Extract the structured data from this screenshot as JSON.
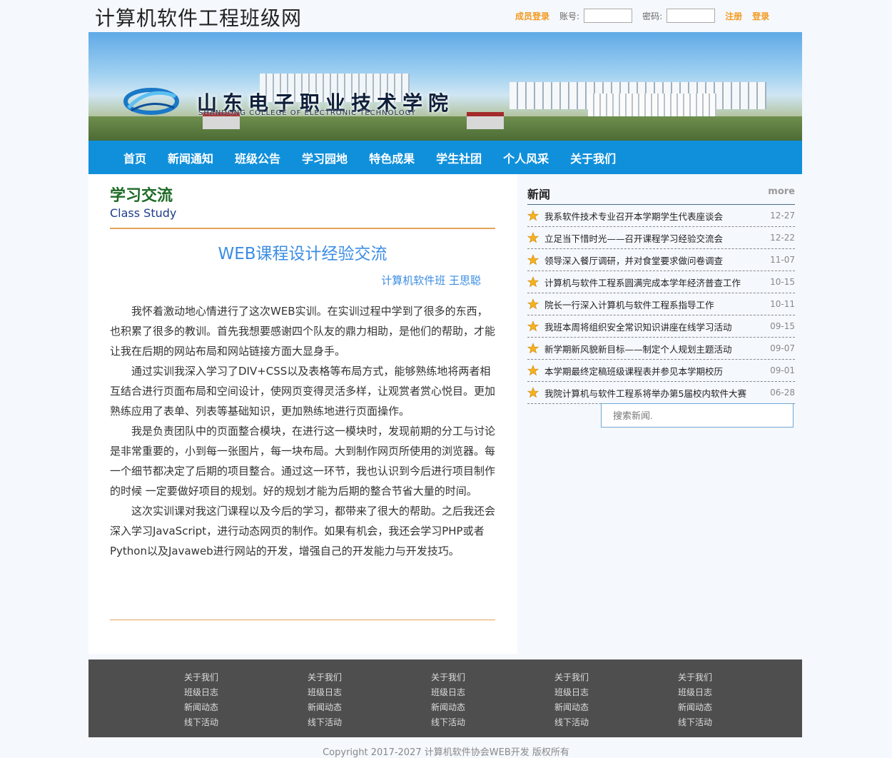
{
  "header": {
    "site_title": "计算机软件工程班级网",
    "member_login": "成员登录",
    "account_label": "账号:",
    "password_label": "密码:",
    "register": "注册",
    "login": "登录"
  },
  "banner": {
    "school_name_cn": "山东电子职业技术学院",
    "school_name_en": "SHANDONG COLLEGE OF ELECTRONIC TECHNOLOGY"
  },
  "nav": [
    "首页",
    "新闻通知",
    "班级公告",
    "学习园地",
    "特色成果",
    "学生社团",
    "个人风采",
    "关于我们"
  ],
  "main": {
    "section_title": "学习交流",
    "section_subtitle": "Class Study",
    "article": {
      "title": "WEB课程设计经验交流",
      "author": "计算机软件班 王思聪",
      "paragraphs": [
        "我怀着激动地心情进行了这次WEB实训。在实训过程中学到了很多的东西，也积累了很多的教训。首先我想要感谢四个队友的鼎力相助，是他们的帮助，才能让我在后期的网站布局和网站链接方面大显身手。",
        "通过实训我深入学习了DIV+CSS以及表格等布局方式，能够熟练地将两者相互结合进行页面布局和空间设计，使网页变得灵活多样，让观赏者赏心悦目。更加熟练应用了表单、列表等基础知识，更加熟练地进行页面操作。",
        "我是负责团队中的页面整合模块，在进行这一模块时，发现前期的分工与讨论是非常重要的，小到每一张图片，每一块布局。大到制作网页所使用的浏览器。每一个细节都决定了后期的项目整合。通过这一环节，我也认识到今后进行项目制作的时候 一定要做好项目的规划。好的规划才能为后期的整合节省大量的时间。",
        "这次实训课对我这门课程以及今后的学习，都带来了很大的帮助。之后我还会深入学习JavaScript，进行动态网页的制作。如果有机会，我还会学习PHP或者Python以及Javaweb进行网站的开发，增强自己的开发能力与开发技巧。"
      ]
    }
  },
  "news": {
    "title": "新闻",
    "more": "more",
    "items": [
      {
        "text": "我系软件技术专业召开本学期学生代表座谈会",
        "date": "12-27"
      },
      {
        "text": "立足当下惜时光——召开课程学习经验交流会",
        "date": "12-22"
      },
      {
        "text": "领导深入餐厅调研，并对食堂要求做问卷调查",
        "date": "11-07"
      },
      {
        "text": "计算机与软件工程系圆满完成本学年经济普查工作",
        "date": "10-15"
      },
      {
        "text": "院长一行深入计算机与软件工程系指导工作",
        "date": "10-11"
      },
      {
        "text": "我班本周将组织安全常识知识讲座在线学习活动",
        "date": "09-15"
      },
      {
        "text": "新学期新风貌新目标——制定个人规划主题活动",
        "date": "09-07"
      },
      {
        "text": "本学期最终定稿班级课程表并参见本学期校历",
        "date": "09-01"
      },
      {
        "text": "我院计算机与软件工程系将举办第5届校内软件大赛",
        "date": "06-28"
      }
    ],
    "search_placeholder": "搜索新闻."
  },
  "footer": {
    "columns": [
      [
        "关于我们",
        "班级日志",
        "新闻动态",
        "线下活动"
      ],
      [
        "关于我们",
        "班级日志",
        "新闻动态",
        "线下活动"
      ],
      [
        "关于我们",
        "班级日志",
        "新闻动态",
        "线下活动"
      ],
      [
        "关于我们",
        "班级日志",
        "新闻动态",
        "线下活动"
      ],
      [
        "关于我们",
        "班级日志",
        "新闻动态",
        "线下活动"
      ]
    ],
    "copyright": "Copyright 2017-2027 计算机软件协会WEB开发 版权所有"
  },
  "colors": {
    "nav_bg": "#1090db",
    "accent_orange": "#f39a1e",
    "link_blue": "#3b8de4",
    "footer_bg": "#4e4e4e"
  },
  "icons": {
    "news_bullet": "star-icon"
  }
}
